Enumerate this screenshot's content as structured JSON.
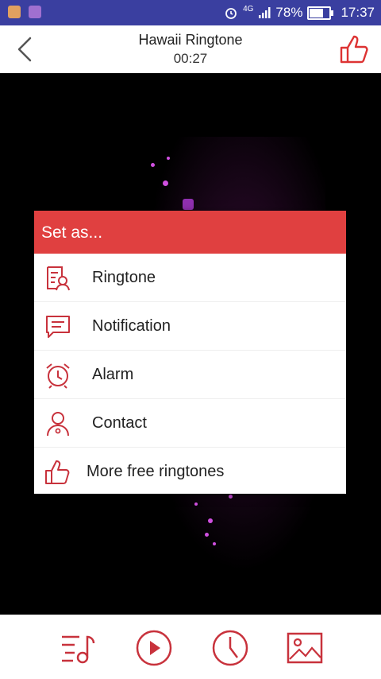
{
  "status_bar": {
    "network": "4G",
    "battery": "78%",
    "clock": "17:37"
  },
  "header": {
    "title": "Hawaii Ringtone",
    "time": "00:27"
  },
  "dialog": {
    "title": "Set as...",
    "options": [
      {
        "label": "Ringtone",
        "icon": "ringtone-icon"
      },
      {
        "label": "Notification",
        "icon": "notification-icon"
      },
      {
        "label": "Alarm",
        "icon": "alarm-icon"
      },
      {
        "label": "Contact",
        "icon": "contact-icon"
      },
      {
        "label": "More free ringtones",
        "icon": "thumbs-up-icon"
      }
    ]
  },
  "colors": {
    "accent": "#e04040",
    "status_bar": "#3a3fa0",
    "icon": "#c8323c"
  },
  "bottom_bar": [
    "playlist-icon",
    "play-icon",
    "clock-icon",
    "image-icon"
  ]
}
